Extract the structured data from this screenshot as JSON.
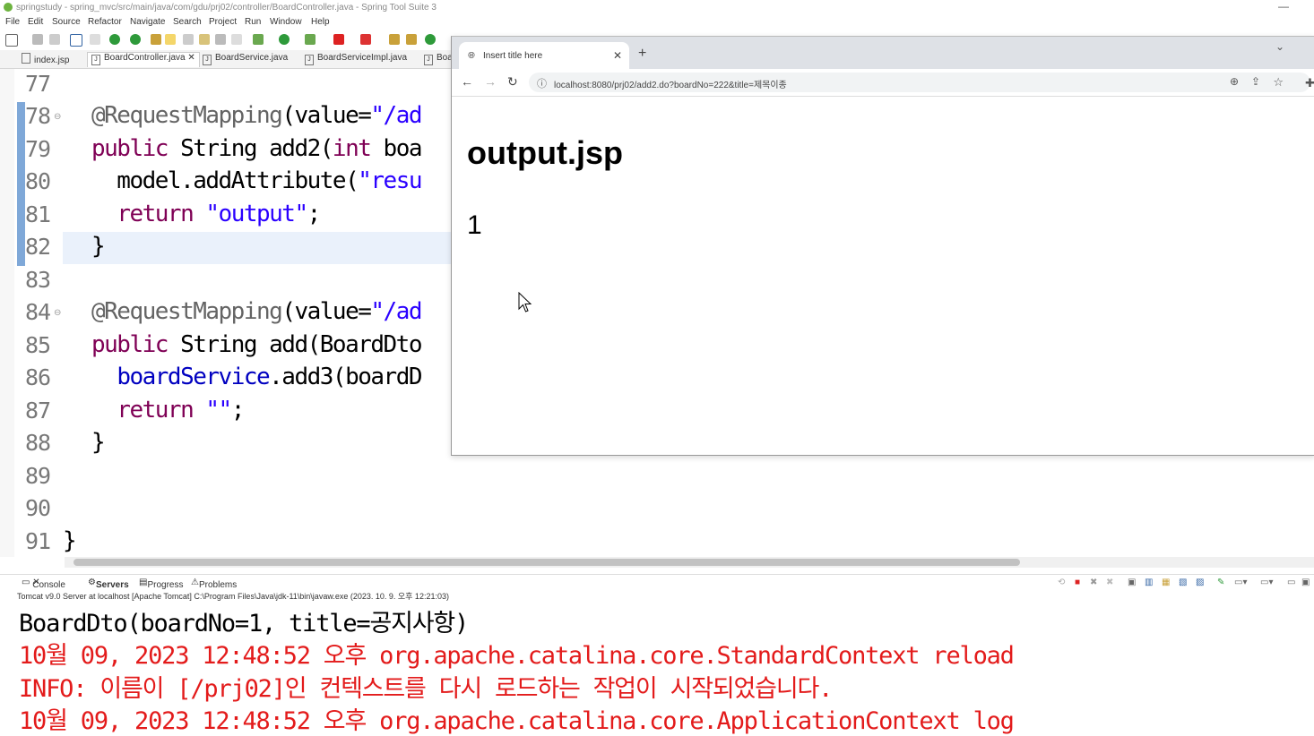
{
  "window": {
    "title": "springstudy - spring_mvc/src/main/java/com/gdu/prj02/controller/BoardController.java - Spring Tool Suite 3"
  },
  "menu": [
    "File",
    "Edit",
    "Source",
    "Refactor",
    "Navigate",
    "Search",
    "Project",
    "Run",
    "Window",
    "Help"
  ],
  "editor_tabs": [
    {
      "label": "index.jsp",
      "active": false
    },
    {
      "label": "BoardController.java",
      "active": true
    },
    {
      "label": "BoardService.java",
      "active": false
    },
    {
      "label": "BoardServiceImpl.java",
      "active": false
    },
    {
      "label": "Boa",
      "active": false
    }
  ],
  "code_lines": [
    {
      "no": "77",
      "text": ""
    },
    {
      "no": "78",
      "text": "@RequestMapping(value=\"/ad"
    },
    {
      "no": "79",
      "text": "public String add2(int boa"
    },
    {
      "no": "80",
      "text": "  model.addAttribute(\"resu"
    },
    {
      "no": "81",
      "text": "  return \"output\";"
    },
    {
      "no": "82",
      "text": "}"
    },
    {
      "no": "83",
      "text": ""
    },
    {
      "no": "84",
      "text": "@RequestMapping(value=\"/ad"
    },
    {
      "no": "85",
      "text": "public String add(BoardDto"
    },
    {
      "no": "86",
      "text": "  boardService.add3(boardD"
    },
    {
      "no": "87",
      "text": "  return \"\";"
    },
    {
      "no": "88",
      "text": "}"
    },
    {
      "no": "89",
      "text": ""
    },
    {
      "no": "90",
      "text": ""
    },
    {
      "no": "91",
      "text": "}"
    }
  ],
  "bottom_panel": {
    "tabs": [
      "Console",
      "Servers",
      "Progress",
      "Problems"
    ],
    "server_info": "Tomcat v9.0 Server at localhost [Apache Tomcat] C:\\Program Files\\Java\\jdk-11\\bin\\javaw.exe  (2023. 10. 9. 오후 12:21:03)",
    "console_lines": [
      {
        "text": "BoardDto(boardNo=1, title=공지사항)",
        "color": "black"
      },
      {
        "text": "10월 09, 2023 12:48:52 오후 org.apache.catalina.core.StandardContext reload",
        "color": "red"
      },
      {
        "text": "INFO: 이름이 [/prj02]인 컨텍스트를 다시 로드하는 작업이 시작되었습니다.",
        "color": "red"
      },
      {
        "text": "10월 09, 2023 12:48:52 오후 org.apache.catalina.core.ApplicationContext log",
        "color": "red"
      }
    ]
  },
  "browser": {
    "tab_title": "Insert title here",
    "url": "localhost:8080/prj02/add2.do?boardNo=222&title=제목이종",
    "page_heading": "output.jsp",
    "page_result": "1"
  },
  "colors": {
    "keyword": "#7f0055",
    "string": "#2a00ff",
    "console_error": "#e31b1b",
    "fold_marker": "#7fa8d8"
  }
}
